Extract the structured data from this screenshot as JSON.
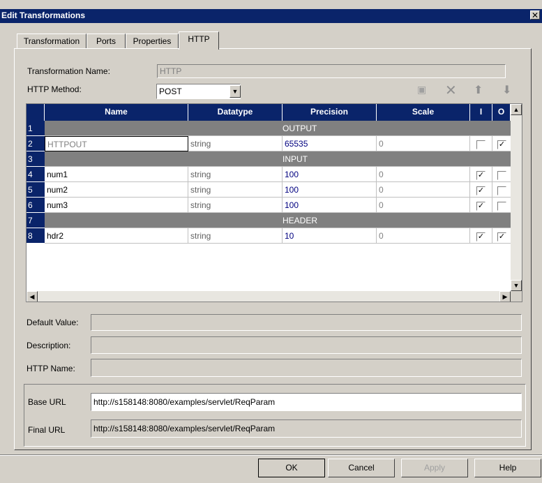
{
  "window": {
    "title": "Edit Transformations",
    "close": "✕"
  },
  "tabs": [
    {
      "label": "Transformation"
    },
    {
      "label": "Ports"
    },
    {
      "label": "Properties"
    },
    {
      "label": "HTTP",
      "active": true
    }
  ],
  "form": {
    "transformation_name_label": "Transformation Name:",
    "transformation_name_value": "HTTP",
    "http_method_label": "HTTP Method:",
    "http_method_value": "POST"
  },
  "grid": {
    "columns": [
      "Name",
      "Datatype",
      "Precision",
      "Scale",
      "I",
      "O"
    ],
    "rows": [
      {
        "num": "1",
        "group": "OUTPUT"
      },
      {
        "num": "2",
        "name": "HTTPOUT",
        "datatype": "string",
        "precision": "65535",
        "scale": "0",
        "i": false,
        "o": true
      },
      {
        "num": "3",
        "group": "INPUT"
      },
      {
        "num": "4",
        "name": "num1",
        "datatype": "string",
        "precision": "100",
        "scale": "0",
        "i": true,
        "o": false
      },
      {
        "num": "5",
        "name": "num2",
        "datatype": "string",
        "precision": "100",
        "scale": "0",
        "i": true,
        "o": false
      },
      {
        "num": "6",
        "name": "num3",
        "datatype": "string",
        "precision": "100",
        "scale": "0",
        "i": true,
        "o": false
      },
      {
        "num": "7",
        "group": "HEADER"
      },
      {
        "num": "8",
        "name": "hdr2",
        "datatype": "string",
        "precision": "10",
        "scale": "0",
        "i": true,
        "o": true
      }
    ]
  },
  "details": {
    "default_value_label": "Default Value:",
    "description_label": "Description:",
    "http_name_label": "HTTP Name:",
    "base_url_label": "Base URL",
    "base_url_value": "http://s158148:8080/examples/servlet/ReqParam",
    "final_url_label": "Final URL",
    "final_url_value": "http://s158148:8080/examples/servlet/ReqParam"
  },
  "buttons": {
    "ok": "OK",
    "cancel": "Cancel",
    "apply": "Apply",
    "help": "Help"
  },
  "colors": {
    "titlebar": "#0a246a",
    "face": "#d4d0c8",
    "precision_text": "#000080"
  }
}
